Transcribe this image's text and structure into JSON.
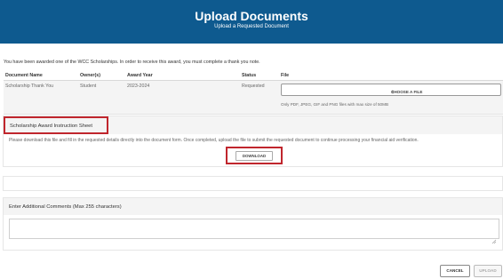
{
  "header": {
    "title": "Upload Documents",
    "subtitle": "Upload a Requested Document"
  },
  "intro_text": "You have been awarded one of the WCC Scholarships.  In order to receive this award, you must complete a thank you note.",
  "documents_table": {
    "columns": [
      "Document Name",
      "Owner(s)",
      "Award Year",
      "Status",
      "File"
    ],
    "rows": [
      {
        "document_name": "Scholarship Thank You",
        "owner": "Student",
        "award_year": "2023-2024",
        "status": "Requested",
        "choose_file_label": "CHOOSE A FILE",
        "file_note": "Only PDF, JPEG, GIF and PNG files with max size of 50MB"
      }
    ]
  },
  "instruction_sheet": {
    "title": "Scholarship Award Instruction Sheet",
    "text": "Please download this file and fill in the requested details directly into the document form. Once completed, upload the file to submit the requested document to continue processing your financial aid verification.",
    "download_label": "DOWNLOAD"
  },
  "comments": {
    "label": "Enter Additional Comments (Max 255 characters)",
    "value": ""
  },
  "actions": {
    "cancel_label": "CANCEL",
    "upload_label": "UPLOAD"
  },
  "colors": {
    "header_bg": "#0e5a8f",
    "highlight": "#c0262d"
  }
}
